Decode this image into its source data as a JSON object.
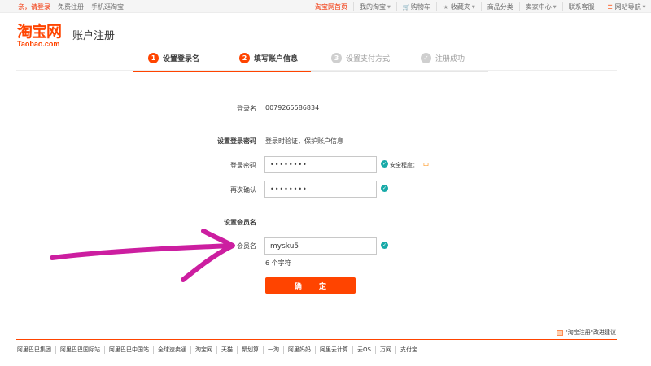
{
  "topbar": {
    "login": "亲，请登录",
    "register": "免费注册",
    "mobile": "手机逛淘宝",
    "right": [
      "淘宝网首页",
      "我的淘宝",
      "购物车",
      "收藏夹",
      "商品分类",
      "卖家中心",
      "联系客服",
      "网站导航"
    ]
  },
  "header": {
    "logo_cn": "淘宝网",
    "logo_en": "Taobao.com",
    "title": "账户注册"
  },
  "steps": [
    {
      "num": "1",
      "label": "设置登录名",
      "state": "done"
    },
    {
      "num": "2",
      "label": "填写账户信息",
      "state": "active"
    },
    {
      "num": "3",
      "label": "设置支付方式",
      "state": "pending"
    },
    {
      "num": "✓",
      "label": "注册成功",
      "state": "pending"
    }
  ],
  "form": {
    "login_name_label": "登录名",
    "login_name_value": "0079265586834",
    "pw_section_label": "设置登录密码",
    "pw_section_hint": "登录时验证，保护账户信息",
    "pw_label": "登录密码",
    "pw_value": "••••••••",
    "strength_label": "安全程度：",
    "strength_level": "中",
    "confirm_label": "再次确认",
    "confirm_value": "••••••••",
    "member_section_label": "设置会员名",
    "member_label": "会员名",
    "member_value": "mysku5",
    "member_hint": "6 个字符",
    "submit": "确 定"
  },
  "footer": {
    "feedback": "\"淘宝注册\"改进建议",
    "links": [
      "阿里巴巴集团",
      "阿里巴巴国际站",
      "阿里巴巴中国站",
      "全球速卖通",
      "淘宝网",
      "天猫",
      "聚划算",
      "一淘",
      "阿里妈妈",
      "阿里云计算",
      "云OS",
      "万网",
      "支付宝"
    ]
  },
  "colors": {
    "brand": "#ff4400",
    "ok": "#18aaa8",
    "arrow": "#cc1ea0"
  }
}
